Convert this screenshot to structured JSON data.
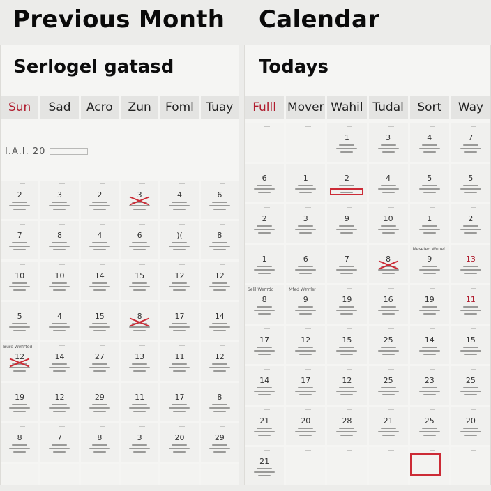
{
  "headings": {
    "left": "Previous Month",
    "right": "Calendar"
  },
  "left_panel": {
    "subtitle": "Serlogel gatasd",
    "days": [
      "Sun",
      "Sad",
      "Acro",
      "Zun",
      "Foml",
      "Tuay"
    ],
    "year_text": "I.A.I. 20",
    "rows": [
      [
        {
          "n": "2"
        },
        {
          "n": "3"
        },
        {
          "n": "2"
        },
        {
          "n": "3",
          "mark": "cross"
        },
        {
          "n": "4"
        },
        {
          "n": "6"
        }
      ],
      [
        {
          "n": "7"
        },
        {
          "n": "8"
        },
        {
          "n": "4"
        },
        {
          "n": "6"
        },
        {
          "n": ")("
        },
        {
          "n": "8"
        }
      ],
      [
        {
          "n": "10"
        },
        {
          "n": "10"
        },
        {
          "n": "14"
        },
        {
          "n": "15"
        },
        {
          "n": "12"
        },
        {
          "n": "12"
        }
      ],
      [
        {
          "n": "5"
        },
        {
          "n": "4"
        },
        {
          "n": "15"
        },
        {
          "n": "8",
          "mark": "cross"
        },
        {
          "n": "17"
        },
        {
          "n": "14"
        }
      ],
      [
        {
          "n": "12",
          "mark": "cross",
          "note": "Bure Wenrtod"
        },
        {
          "n": "14"
        },
        {
          "n": "27"
        },
        {
          "n": "13"
        },
        {
          "n": "11"
        },
        {
          "n": "12"
        }
      ],
      [
        {
          "n": "19"
        },
        {
          "n": "12"
        },
        {
          "n": "29"
        },
        {
          "n": "11"
        },
        {
          "n": "17"
        },
        {
          "n": "8"
        }
      ],
      [
        {
          "n": "8"
        },
        {
          "n": "7"
        },
        {
          "n": "8"
        },
        {
          "n": "3"
        },
        {
          "n": "20"
        },
        {
          "n": "29"
        }
      ],
      [
        {
          "n": ""
        },
        {
          "n": ""
        },
        {
          "n": ""
        },
        {
          "n": ""
        },
        {
          "n": ""
        },
        {
          "n": ""
        }
      ]
    ]
  },
  "right_panel": {
    "subtitle": "Todays",
    "days": [
      "Fulll",
      "Mover",
      "Wahil",
      "Tudal",
      "Sort",
      "Way"
    ],
    "rows": [
      [
        {
          "n": ""
        },
        {
          "n": ""
        },
        {
          "n": "1"
        },
        {
          "n": "3"
        },
        {
          "n": "4"
        },
        {
          "n": "7"
        }
      ],
      [
        {
          "n": "6"
        },
        {
          "n": "1"
        },
        {
          "n": "2",
          "mark": "box"
        },
        {
          "n": "4"
        },
        {
          "n": "5"
        },
        {
          "n": "5"
        }
      ],
      [
        {
          "n": "2"
        },
        {
          "n": "3"
        },
        {
          "n": "9"
        },
        {
          "n": "10"
        },
        {
          "n": "1"
        },
        {
          "n": "2"
        }
      ],
      [
        {
          "n": "1"
        },
        {
          "n": "6"
        },
        {
          "n": "7"
        },
        {
          "n": "8",
          "mark": "cross"
        },
        {
          "n": "9",
          "note": "Meseted Wunel"
        },
        {
          "n": "13",
          "red": true
        }
      ],
      [
        {
          "n": "8",
          "note": "Selil Wenrdo"
        },
        {
          "n": "9",
          "note": "Mfed Wevilsr"
        },
        {
          "n": "19"
        },
        {
          "n": "16"
        },
        {
          "n": "19"
        },
        {
          "n": "11",
          "red": true
        }
      ],
      [
        {
          "n": "17"
        },
        {
          "n": "12"
        },
        {
          "n": "15"
        },
        {
          "n": "25"
        },
        {
          "n": "14"
        },
        {
          "n": "15"
        }
      ],
      [
        {
          "n": "14"
        },
        {
          "n": "17"
        },
        {
          "n": "12"
        },
        {
          "n": "25"
        },
        {
          "n": "23"
        },
        {
          "n": "25"
        }
      ],
      [
        {
          "n": "21"
        },
        {
          "n": "20"
        },
        {
          "n": "28"
        },
        {
          "n": "21"
        },
        {
          "n": "25"
        },
        {
          "n": "20"
        }
      ],
      [
        {
          "n": "21"
        },
        {
          "n": ""
        },
        {
          "n": ""
        },
        {
          "n": ""
        },
        {
          "n": ""
        },
        {
          "n": ""
        }
      ]
    ]
  },
  "colors": {
    "accent_red": "#cc2b36",
    "day_red": "#b01c2e"
  }
}
